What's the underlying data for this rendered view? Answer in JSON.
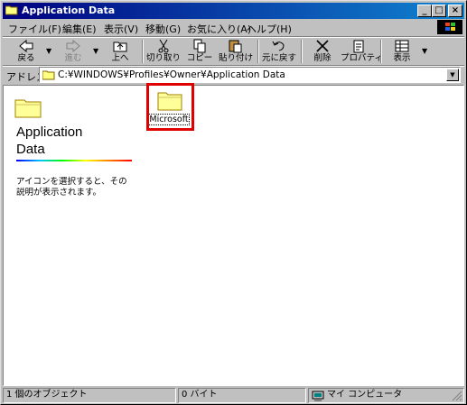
{
  "window": {
    "title": "Application Data"
  },
  "title_buttons": {
    "minimize": "_",
    "maximize": "□",
    "close": "×"
  },
  "menu": [
    "ファイル(F)",
    "編集(E)",
    "表示(V)",
    "移動(G)",
    "お気に入り(A)",
    "ヘルプ(H)"
  ],
  "toolbar": {
    "back": "戻る",
    "forward": "進む",
    "up": "上へ",
    "cut": "切り取り",
    "copy": "コピー",
    "paste": "貼り付け",
    "undo": "元に戻す",
    "delete": "削除",
    "properties": "プロパティ",
    "views": "表示"
  },
  "address": {
    "label": "アドレス",
    "path": "C:¥WINDOWS¥Profiles¥Owner¥Application Data"
  },
  "left_pane": {
    "title_line1": "Application",
    "title_line2": "Data",
    "description": "アイコンを選択すると、その説明が表示されます。"
  },
  "files": [
    {
      "name": "Microsoft"
    }
  ],
  "status": {
    "objects": "1 個のオブジェクト",
    "size": "0 バイト",
    "zone": "マイ コンピュータ"
  },
  "colors": {
    "title_gradient_start": "#000080",
    "title_gradient_end": "#1084d0",
    "highlight": "#e00000",
    "window_bg": "#c0c0c0"
  }
}
